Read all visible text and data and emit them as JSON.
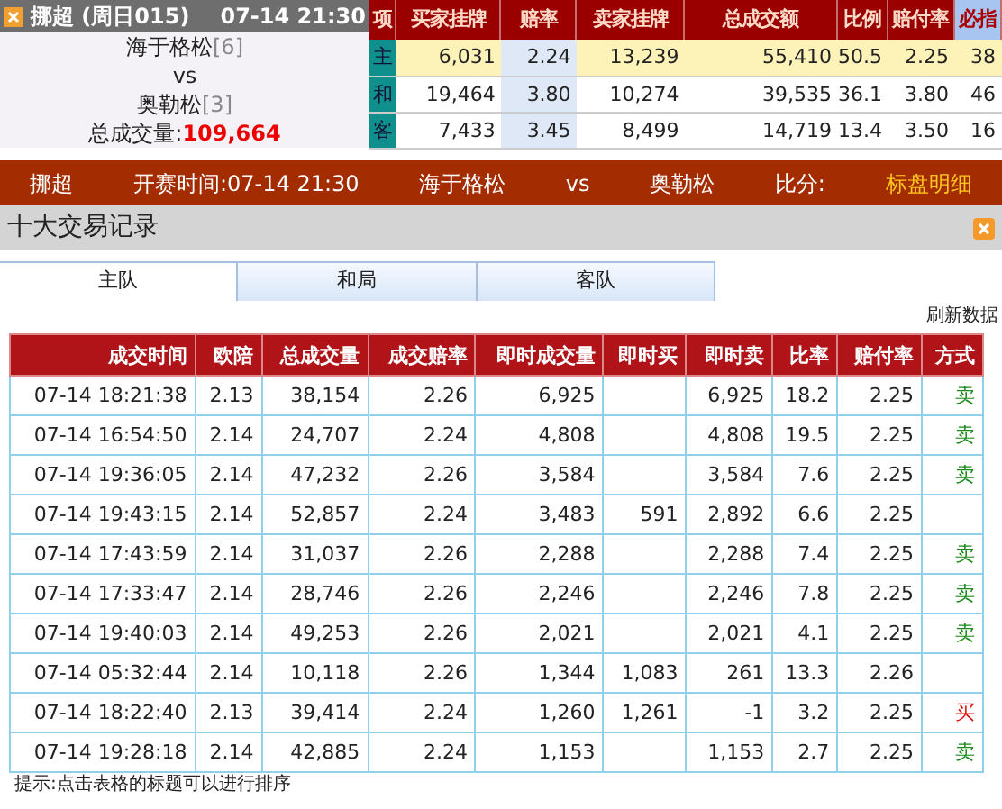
{
  "match_panel": {
    "title": "挪超 (周日015)",
    "time": "07-14 21:30",
    "home": "海于格松",
    "home_rank": "[6]",
    "vs": "vs",
    "away": "奥勒松",
    "away_rank": "[3]",
    "volume_label": "总成交量:",
    "volume": "109,664"
  },
  "summary": {
    "columns": [
      "项",
      "买家挂牌",
      "赔率",
      "卖家挂牌",
      "总成交额",
      "比例",
      "赔付率",
      "必指"
    ],
    "rows": [
      {
        "selected": true,
        "cells": [
          "主",
          "6,031",
          "2.24",
          "13,239",
          "55,410",
          "50.5",
          "2.25",
          "38"
        ]
      },
      {
        "selected": false,
        "cells": [
          "和",
          "19,464",
          "3.80",
          "10,274",
          "39,535",
          "36.1",
          "3.80",
          "46"
        ]
      },
      {
        "selected": false,
        "cells": [
          "客",
          "7,433",
          "3.45",
          "8,499",
          "14,719",
          "13.4",
          "3.50",
          "16"
        ]
      }
    ]
  },
  "info_bar": [
    "挪超",
    "开赛时间:07-14 21:30",
    "海于格松",
    "vs",
    "奥勒松",
    "比分:",
    "标盘明细"
  ],
  "panel_title": "十大交易记录",
  "tabs": [
    {
      "label": "主队",
      "selected": true
    },
    {
      "label": "和局",
      "selected": false
    },
    {
      "label": "客队",
      "selected": false
    }
  ],
  "refresh": "刷新数据",
  "trades": {
    "columns": [
      "成交时间",
      "欧陪",
      "总成交量",
      "成交赔率",
      "即时成交量",
      "即时买",
      "即时卖",
      "比率",
      "赔付率",
      "方式"
    ],
    "rows": [
      {
        "cells": [
          "07-14 18:21:38",
          "2.13",
          "38,154",
          "2.26",
          "6,925",
          "",
          "6,925",
          "18.2",
          "2.25",
          "卖"
        ],
        "kind": "sell"
      },
      {
        "cells": [
          "07-14 16:54:50",
          "2.14",
          "24,707",
          "2.24",
          "4,808",
          "",
          "4,808",
          "19.5",
          "2.25",
          "卖"
        ],
        "kind": "sell"
      },
      {
        "cells": [
          "07-14 19:36:05",
          "2.14",
          "47,232",
          "2.26",
          "3,584",
          "",
          "3,584",
          "7.6",
          "2.25",
          "卖"
        ],
        "kind": "sell"
      },
      {
        "cells": [
          "07-14 19:43:15",
          "2.14",
          "52,857",
          "2.24",
          "3,483",
          "591",
          "2,892",
          "6.6",
          "2.25",
          ""
        ],
        "kind": "none"
      },
      {
        "cells": [
          "07-14 17:43:59",
          "2.14",
          "31,037",
          "2.26",
          "2,288",
          "",
          "2,288",
          "7.4",
          "2.25",
          "卖"
        ],
        "kind": "sell"
      },
      {
        "cells": [
          "07-14 17:33:47",
          "2.14",
          "28,746",
          "2.26",
          "2,246",
          "",
          "2,246",
          "7.8",
          "2.25",
          "卖"
        ],
        "kind": "sell"
      },
      {
        "cells": [
          "07-14 19:40:03",
          "2.14",
          "49,253",
          "2.26",
          "2,021",
          "",
          "2,021",
          "4.1",
          "2.25",
          "卖"
        ],
        "kind": "sell"
      },
      {
        "cells": [
          "07-14 05:32:44",
          "2.14",
          "10,118",
          "2.26",
          "1,344",
          "1,083",
          "261",
          "13.3",
          "2.26",
          ""
        ],
        "kind": "none"
      },
      {
        "cells": [
          "07-14 18:22:40",
          "2.13",
          "39,414",
          "2.24",
          "1,260",
          "1,261",
          "-1",
          "3.2",
          "2.25",
          "买"
        ],
        "kind": "buy"
      },
      {
        "cells": [
          "07-14 19:28:18",
          "2.14",
          "42,885",
          "2.24",
          "1,153",
          "",
          "1,153",
          "2.7",
          "2.25",
          "卖"
        ],
        "kind": "sell"
      }
    ]
  },
  "hint": "提示:点击表格的标题可以进行排序"
}
